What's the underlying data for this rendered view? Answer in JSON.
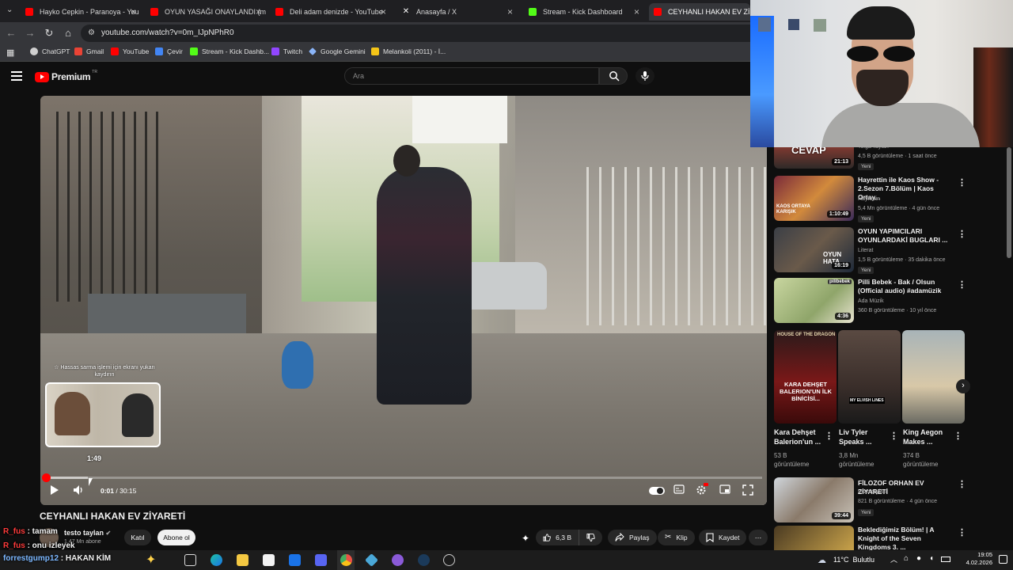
{
  "browser": {
    "tabs": [
      {
        "label": "Hayko Cepkin - Paranoya - You",
        "color": "#ff0000"
      },
      {
        "label": "OYUN YASAĞI ONAYLANDI (m",
        "color": "#ff0000"
      },
      {
        "label": "Deli adam denizde - YouTube",
        "color": "#ff0000"
      },
      {
        "label": "Anasayfa / X",
        "color": "#ffffff"
      },
      {
        "label": "Stream - Kick Dashboard",
        "color": "#53fc18"
      },
      {
        "label": "CEYHANLI HAKAN EV ZİYARET",
        "color": "#ff0000"
      }
    ],
    "url": "youtube.com/watch?v=0m_IJpNPhR0",
    "bookmarks": [
      {
        "label": "ChatGPT",
        "color": "#cfcfcf"
      },
      {
        "label": "Gmail",
        "color": "#ea4335"
      },
      {
        "label": "YouTube",
        "color": "#ff0000"
      },
      {
        "label": "Çevir",
        "color": "#4285f4"
      },
      {
        "label": "Stream - Kick Dashb...",
        "color": "#53fc18"
      },
      {
        "label": "Twitch",
        "color": "#9146ff"
      },
      {
        "label": "Google Gemini",
        "color": "#8ab4f8"
      },
      {
        "label": "Melankoli (2011) - İ...",
        "color": "#f5c518"
      }
    ]
  },
  "youtube": {
    "logo_text": "Premium",
    "logo_region": "TR",
    "search_placeholder": "Ara"
  },
  "player": {
    "hint": "☆ Hassas sarma işlemi için ekranı yukarı kaydırın",
    "preview_time": "1:49",
    "current_time": "0:01",
    "separator": " / ",
    "duration": "30:15",
    "progress": 0.001,
    "buffered": 0.06
  },
  "video": {
    "title": "CEYHANLI HAKAN EV ZİYARETİ",
    "channel": "testo taylan",
    "subscribers": "1,47 Mn abone",
    "join_label": "Katıl",
    "subscribe_label": "Abone ol",
    "likes": "6,3 B",
    "share_label": "Paylaş",
    "clip_label": "Klip",
    "save_label": "Kaydet"
  },
  "sidebar": {
    "top_partial": {
      "channel": "Tolga Taylan",
      "meta": "4,5 B görüntüleme · 1 saat önce",
      "badge": "Yeni",
      "duration": "21:13",
      "thumb_text": "CEVAP"
    },
    "items": [
      {
        "title": "Hayrettin ile Kaos Show - 2.Sezon 7.Bölüm | Kaos Ortay...",
        "channel": "Hayrettin",
        "meta": "5,4 Mn görüntüleme · 4 gün önce",
        "badge": "Yeni",
        "duration": "1:10:49",
        "thumb_text": "KAOS ORTAYA KARIŞIK"
      },
      {
        "title": "OYUN YAPIMCILARI OYUNLARDAKİ BUGLARI ...",
        "channel": "Literat",
        "meta": "1,5 B görüntüleme · 35 dakika önce",
        "badge": "Yeni",
        "duration": "16:19",
        "thumb_text": "OYUN HATA"
      },
      {
        "title": "Pilli Bebek - Bak / Olsun (Official audio) #adamüzik",
        "channel": "Ada Müzik",
        "meta": "360 B görüntüleme · 10 yıl önce",
        "badge": "",
        "duration": "4:36",
        "thumb_text": "pilibebek"
      }
    ],
    "shorts": [
      {
        "title": "Kara Dehşet Balerion'un ...",
        "views_num": "53 B",
        "views_word": "görüntüleme",
        "thumb_text": "KARA DEHŞET BALERION'UN İLK BİNİCİSİ...",
        "top_text": "HOUSE OF THE DRAGON"
      },
      {
        "title": "Liv Tyler Speaks ...",
        "views_num": "3,8 Mn",
        "views_word": "görüntüleme",
        "thumb_text": "MY ELVISH LINES",
        "top_text": ""
      },
      {
        "title": "King Aegon Makes ...",
        "views_num": "374 B",
        "views_word": "görüntüleme",
        "thumb_text": "",
        "top_text": ""
      }
    ],
    "bottom_items": [
      {
        "title": "FİLOZOF ORHAN EV ZİYARETİ",
        "channel": "testo taylan",
        "meta": "821 B görüntüleme · 4 gün önce",
        "badge": "Yeni",
        "duration": "39:44"
      },
      {
        "title": "Beklediğimiz Bölüm! | A Knight of the Seven Kingdoms 3. ...",
        "channel": "",
        "meta": "",
        "badge": "",
        "duration": ""
      }
    ]
  },
  "chat_overlay": [
    {
      "user": "R_fus",
      "message": " : tamam"
    },
    {
      "user": "R_fus",
      "message": " : onu izleyek"
    },
    {
      "user": "forrestgump12",
      "message": " : HAKAN KİM"
    }
  ],
  "taskbar": {
    "weather": "11°C  Bulutlu",
    "time": "19:05",
    "date": "4.02.2026"
  },
  "colors": {
    "accent": "#ff0000",
    "background": "#0f0f0f"
  }
}
